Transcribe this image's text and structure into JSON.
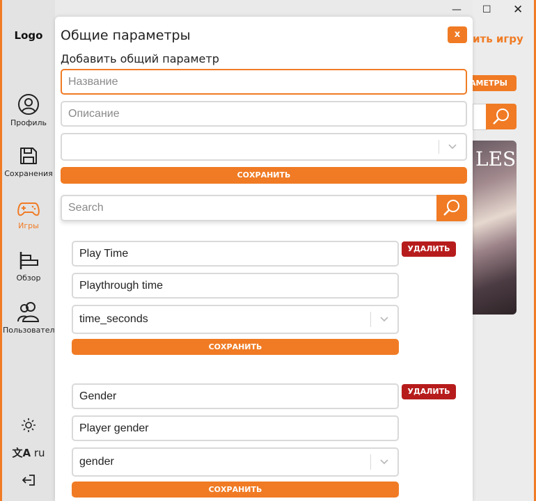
{
  "sidebar": {
    "logo": "Logo",
    "items": [
      {
        "label": "Профиль",
        "icon": "user-circle-icon"
      },
      {
        "label": "Сохранения",
        "icon": "save-icon"
      },
      {
        "label": "Игры",
        "icon": "gamepad-icon",
        "active": true
      },
      {
        "label": "Обзор",
        "icon": "overview-icon"
      },
      {
        "label": "Пользователи",
        "icon": "users-icon"
      }
    ],
    "language": "ru"
  },
  "background": {
    "link_text": "ить игру",
    "badge_text": "АМЕТРЫ",
    "image_text": "LES"
  },
  "modal": {
    "title": "Общие параметры",
    "close_label": "x",
    "add_section_title": "Добавить общий параметр",
    "new_param": {
      "name_placeholder": "Название",
      "description_placeholder": "Описание",
      "type_value": "",
      "save_label": "СОХРАНИТЬ"
    },
    "search": {
      "placeholder": "Search"
    },
    "params": [
      {
        "name": "Play Time",
        "description": "Playthrough time",
        "type": "time_seconds",
        "delete_label": "УДАЛИТЬ",
        "save_label": "СОХРАНИТЬ"
      },
      {
        "name": "Gender",
        "description": "Player gender",
        "type": "gender",
        "delete_label": "УДАЛИТЬ",
        "save_label": "СОХРАНИТЬ"
      }
    ]
  },
  "colors": {
    "accent": "#f07b24",
    "danger": "#b71c1c"
  }
}
